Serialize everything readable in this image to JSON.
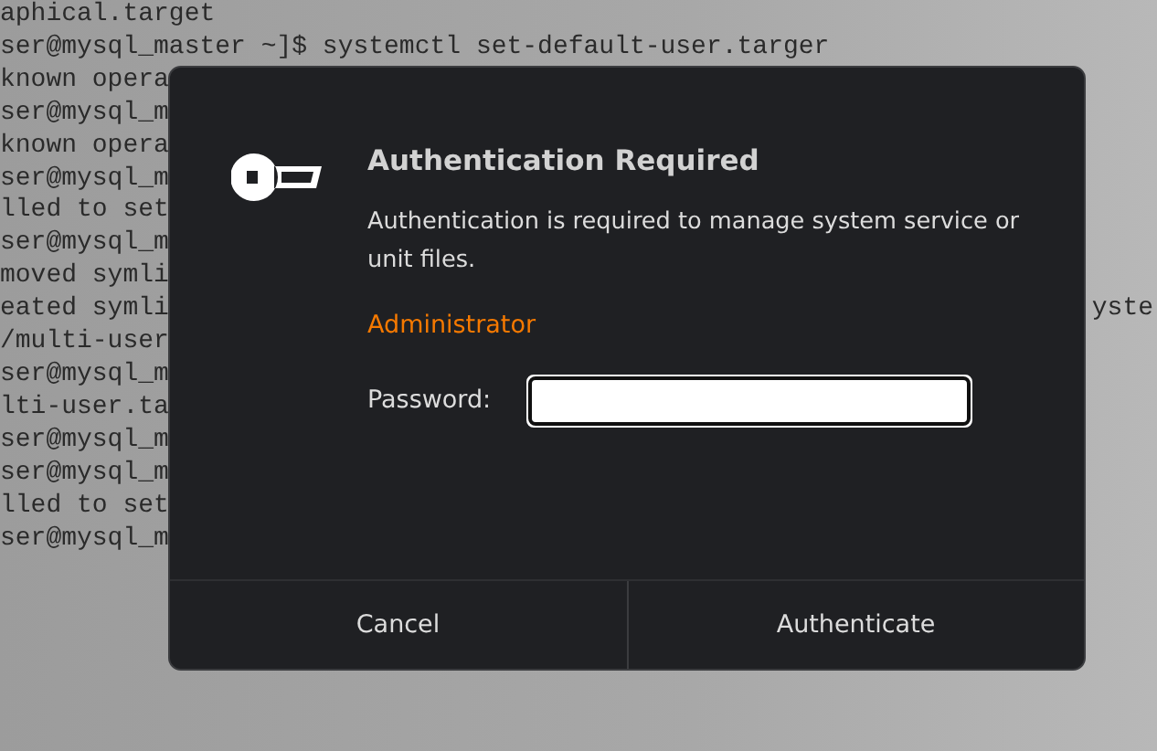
{
  "terminal": {
    "lines": [
      {
        "text": "aphical.target"
      },
      {
        "text": "ser@mysql_master ~]$ systemctl set-default-user.targer"
      },
      {
        "text": "known opera"
      },
      {
        "text": "ser@mysql_m"
      },
      {
        "text": "known opera"
      },
      {
        "text": "ser@mysql_m"
      },
      {
        "text": "lled to set"
      },
      {
        "text": "ser@mysql_m"
      },
      {
        "text": "moved symli"
      },
      {
        "text": "eated symli",
        "right_text": "yste"
      },
      {
        "text": "/multi-user"
      },
      {
        "text": "ser@mysql_m"
      },
      {
        "text": "lti-user.ta"
      },
      {
        "text": "ser@mysql_m"
      },
      {
        "text": "ser@mysql_m"
      },
      {
        "text": "lled to set"
      },
      {
        "text": "ser@mysql_m"
      }
    ]
  },
  "dialog": {
    "title": "Authentication Required",
    "message": "Authentication is required to manage system service or unit files.",
    "user": "Administrator",
    "password": {
      "label": "Password:",
      "focused": true
    },
    "buttons": [
      "Cancel",
      "Authenticate"
    ]
  }
}
